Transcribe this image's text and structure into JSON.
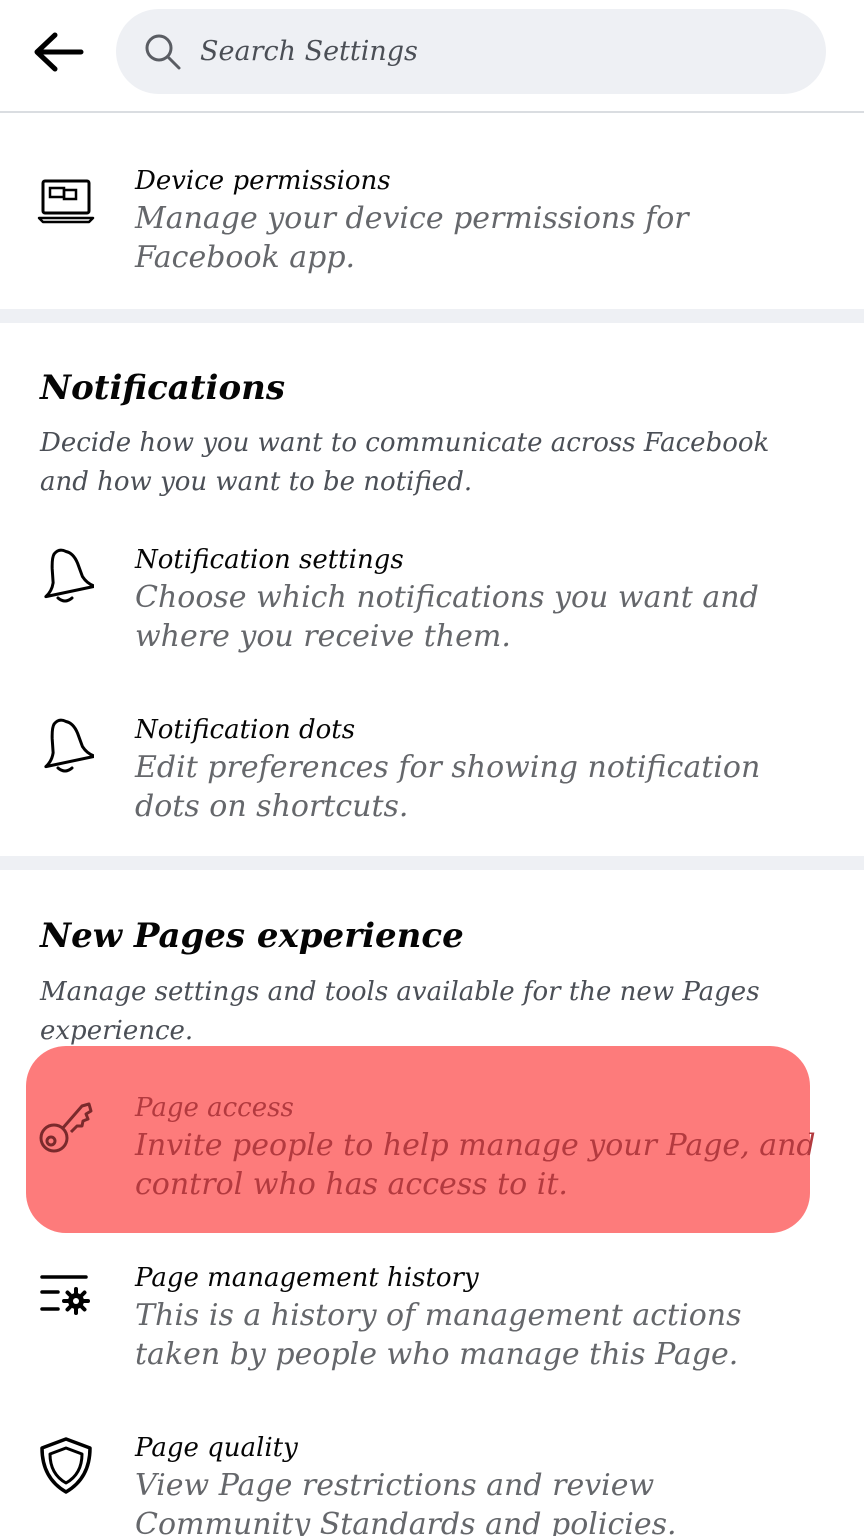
{
  "header": {
    "search_placeholder": "Search Settings"
  },
  "device_permissions": {
    "title": "Device permissions",
    "description": "Manage your device permissions for Facebook app."
  },
  "notifications": {
    "heading": "Notifications",
    "description": "Decide how you want to communicate across Facebook and how you want to be notified.",
    "items": [
      {
        "title": "Notification settings",
        "description": "Choose which notifications you want and where you receive them.",
        "icon": "bell-icon"
      },
      {
        "title": "Notification dots",
        "description": "Edit preferences for showing notification dots on shortcuts.",
        "icon": "bell-icon"
      }
    ]
  },
  "new_pages": {
    "heading": "New Pages experience",
    "description": "Manage settings and tools available for the new Pages experience.",
    "items": [
      {
        "title": "Page access",
        "description": "Invite people to help manage your Page, and control who has access to it.",
        "icon": "key-icon",
        "highlighted": true
      },
      {
        "title": "Page management history",
        "description": "This is a history of management actions taken by people who manage this Page.",
        "icon": "list-gear-icon"
      },
      {
        "title": "Page quality",
        "description": "View Page restrictions and review Community Standards and policies.",
        "icon": "shield-icon"
      }
    ]
  },
  "colors": {
    "highlight": "#fd7b7b",
    "divider": "#eef0f4",
    "search_bg": "#eef0f4"
  }
}
